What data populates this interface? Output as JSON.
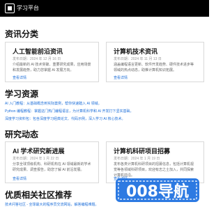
{
  "header": {
    "site_title": "学习平台"
  },
  "sections": {
    "categories": "资讯分类",
    "resources": "学习资源",
    "research": "研究动态",
    "partners": "优质相关社区推荐"
  },
  "categories": [
    {
      "title": "人工智能前沿资讯",
      "meta": "发布日期：2024 年 12 月 16 日",
      "text": "介绍最新的 AI 技术突破、重要研究成果，应用场景和发展趋势，助力您掌握 AI 发展方向。",
      "link": "查看详情"
    },
    {
      "title": "计算机技术资讯",
      "meta": "发布日期：2024 年 11 月 13 日",
      "text": "涵盖编程语言更新、软件开发趋势、硬件技术进步等领域的热点动态，助推计算机知识拓展。",
      "link": "查看详情"
    }
  ],
  "resources": [
    "AI 入门教程：从基础概念到实际案例，帮你快速踏入 AI 领域。",
    "Python 编程教程：掌握这门热门编程语言，为计算机科学和 AI 开发打下坚实基础。",
    "深度学习资料包：包含深度学习经典论文、代码示例，深入学习 AI 核心技术。"
  ],
  "research": [
    {
      "title": "AI 学术研究新进展",
      "meta": "发布日期：2024 年 1 月 22 日",
      "text": "分享全球顶级机构、科研机构在 AI 领域最新的学术研究成果、调查报告，助您了解 AI 前沿发展。",
      "link": "查看详情"
    },
    {
      "title": "计算机科研项目招募",
      "meta": "发布日期：2024 年 1 月 19 日",
      "text": "发布各类计算机科研项目的招募信息，包括计算机视觉等各领域科研项目，欢迎有志之士加入，共同探索计算机前沿。",
      "link": "查看详情"
    }
  ],
  "partners": [
    "技术问答社区 - 全球最大的程序员交流网站，解答编程难题。"
  ],
  "watermark": {
    "text": "008导航"
  }
}
